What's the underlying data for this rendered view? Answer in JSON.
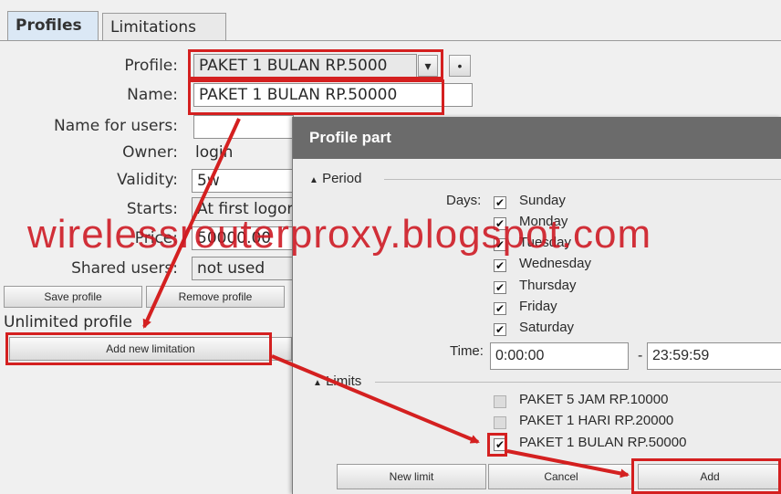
{
  "tabs": [
    {
      "label": "Profiles",
      "active": true
    },
    {
      "label": "Limitations",
      "active": false
    }
  ],
  "form": {
    "profile_label": "Profile:",
    "profile_value": "PAKET 1 BULAN RP.5000",
    "dropdown_glyph": "▾",
    "add_glyph": "•",
    "name_label": "Name:",
    "name_value": "PAKET 1 BULAN RP.50000",
    "name_for_users_label": "Name for users:",
    "owner_label": "Owner:",
    "owner_value": "login",
    "validity_label": "Validity:",
    "validity_value": "5w",
    "starts_label": "Starts:",
    "starts_value": "At first logon",
    "price_label": "Price:",
    "price_value": "50000.00",
    "shared_users_label": "Shared users:",
    "shared_users_value": "not used"
  },
  "buttons": {
    "save_profile": "Save profile",
    "remove_profile": "Remove profile",
    "add_new_limitation": "Add new limitation"
  },
  "unlimited_profile_text": "Unlimited profile",
  "dialog": {
    "title": "Profile part",
    "period_label": "Period",
    "days_label": "Days:",
    "days": [
      {
        "name": "Sunday",
        "checked": true
      },
      {
        "name": "Monday",
        "checked": true
      },
      {
        "name": "Tuesday",
        "checked": true
      },
      {
        "name": "Wednesday",
        "checked": true
      },
      {
        "name": "Thursday",
        "checked": true
      },
      {
        "name": "Friday",
        "checked": true
      },
      {
        "name": "Saturday",
        "checked": true
      }
    ],
    "time_label": "Time:",
    "time_from": "0:00:00",
    "time_dash": "-",
    "time_to": "23:59:59",
    "limits_label": "Limits",
    "limits": [
      {
        "name": "PAKET 5 JAM RP.10000",
        "checked": false
      },
      {
        "name": "PAKET 1 HARI RP.20000",
        "checked": false
      },
      {
        "name": "PAKET 1 BULAN RP.50000",
        "checked": true
      }
    ],
    "buttons": {
      "new_limit": "New limit",
      "cancel": "Cancel",
      "add": "Add"
    }
  },
  "watermark": "wirelessrouterproxy.blogspot.com",
  "colors": {
    "annotation_red": "#d42020",
    "dialog_title_bg": "#6b6b6b",
    "active_tab_bg": "#dbe8f5"
  }
}
